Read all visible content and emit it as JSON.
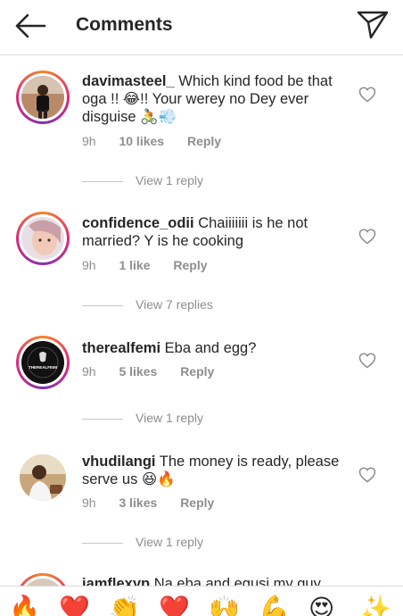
{
  "header": {
    "title": "Comments"
  },
  "comments": [
    {
      "username": "davimasteel_",
      "text": "Which kind food be that oga !! 😂!! Your werey no Dey ever disguise 🚴💨",
      "time": "9h",
      "likes": "10 likes",
      "reply": "Reply",
      "view_replies": "View 1 reply"
    },
    {
      "username": "confidence_odii",
      "text": "Chaiiiiiii is he not married? Y is he cooking",
      "time": "9h",
      "likes": "1 like",
      "reply": "Reply",
      "view_replies": "View 7 replies"
    },
    {
      "username": "therealfemi",
      "text": "Eba and egg?",
      "time": "9h",
      "likes": "5 likes",
      "reply": "Reply",
      "view_replies": "View 1 reply",
      "avatar_text": "THEREALFEMI"
    },
    {
      "username": "vhudilangi",
      "text": "The money is ready, please serve us 😆🔥",
      "time": "9h",
      "likes": "3 likes",
      "reply": "Reply",
      "view_replies": "View 1 reply"
    },
    {
      "username": "iamflexyp",
      "text": "Na eba and egusi my guy"
    }
  ],
  "emoji_bar": [
    "🔥",
    "❤️",
    "👏",
    "❤️",
    "🙌",
    "💪",
    "😍",
    "✨"
  ],
  "colors": {
    "muted": "#8e8e8e",
    "text": "#262626",
    "divider": "#dbdbdb"
  }
}
